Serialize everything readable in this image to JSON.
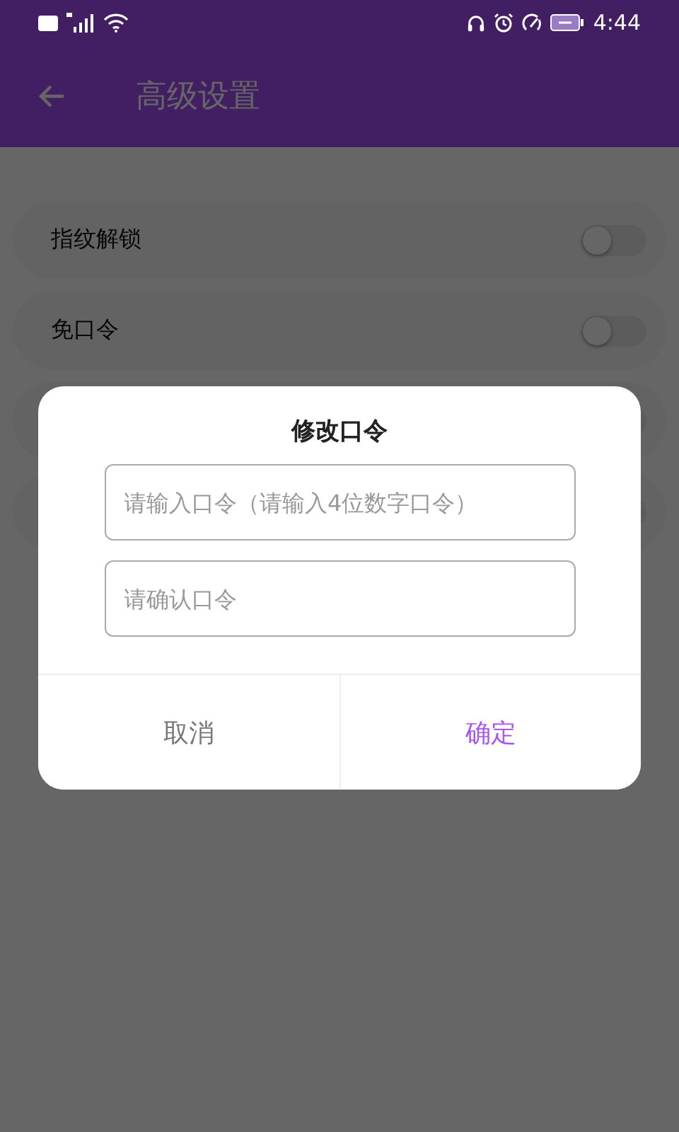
{
  "status_bar": {
    "time": "4:44"
  },
  "app_bar": {
    "title": "高级设置"
  },
  "settings": [
    {
      "label": "指纹解锁",
      "on": false
    },
    {
      "label": "免口令",
      "on": false
    },
    {
      "on": false
    },
    {
      "on": false
    }
  ],
  "dialog": {
    "title": "修改口令",
    "fields": [
      {
        "placeholder": "请输入口令（请输入4位数字口令）"
      },
      {
        "placeholder": "请确认口令"
      }
    ],
    "buttons": [
      {
        "label": "取消",
        "kind": "cancel"
      },
      {
        "label": "确定",
        "kind": "confirm"
      }
    ]
  }
}
